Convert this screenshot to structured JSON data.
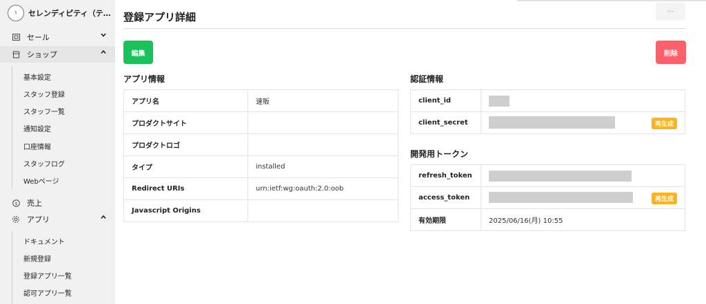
{
  "sidebar": {
    "shop_name": "セレンディピティ（テ…",
    "logo_text": "S",
    "items": [
      {
        "label": "セール",
        "icon": "sale-icon",
        "chevron": "⌄"
      },
      {
        "label": "ショップ",
        "icon": "shop-icon",
        "chevron": "⌃"
      },
      {
        "label": "売上",
        "icon": "coin-icon"
      },
      {
        "label": "アプリ",
        "icon": "gear-icon",
        "chevron": "⌃"
      }
    ],
    "shop_sub": [
      "基本設定",
      "スタッフ登録",
      "スタッフ一覧",
      "通知設定",
      "口座情報",
      "スタッフログ",
      "Webページ"
    ],
    "app_sub": [
      "ドキュメント",
      "新規登録",
      "登録アプリ一覧",
      "認可アプリ一覧"
    ]
  },
  "header": {
    "title": "登録アプリ詳細",
    "more": "···"
  },
  "actions": {
    "edit": "編集",
    "delete": "削除"
  },
  "app_info": {
    "title": "アプリ情報",
    "rows": [
      {
        "key": "アプリ名",
        "value": "速販"
      },
      {
        "key": "プロダクトサイト",
        "value": ""
      },
      {
        "key": "プロダクトロゴ",
        "value": ""
      },
      {
        "key": "タイプ",
        "value": "installed"
      },
      {
        "key": "Redirect URIs",
        "value": "urn:ietf:wg:oauth:2.0:oob"
      },
      {
        "key": "Javascript Origins",
        "value": ""
      }
    ]
  },
  "auth_info": {
    "title": "認証情報",
    "rows": [
      {
        "key": "client_id"
      },
      {
        "key": "client_secret",
        "action": "再生成"
      }
    ]
  },
  "dev_token": {
    "title": "開発用トークン",
    "rows": [
      {
        "key": "refresh_token"
      },
      {
        "key": "access_token",
        "action": "再生成"
      },
      {
        "key": "有効期限",
        "value": "2025/06/16(月) 10:55"
      }
    ]
  },
  "colors": {
    "edit": "#19c25b",
    "delete": "#ff6069",
    "regenerate": "#ffb21e"
  }
}
